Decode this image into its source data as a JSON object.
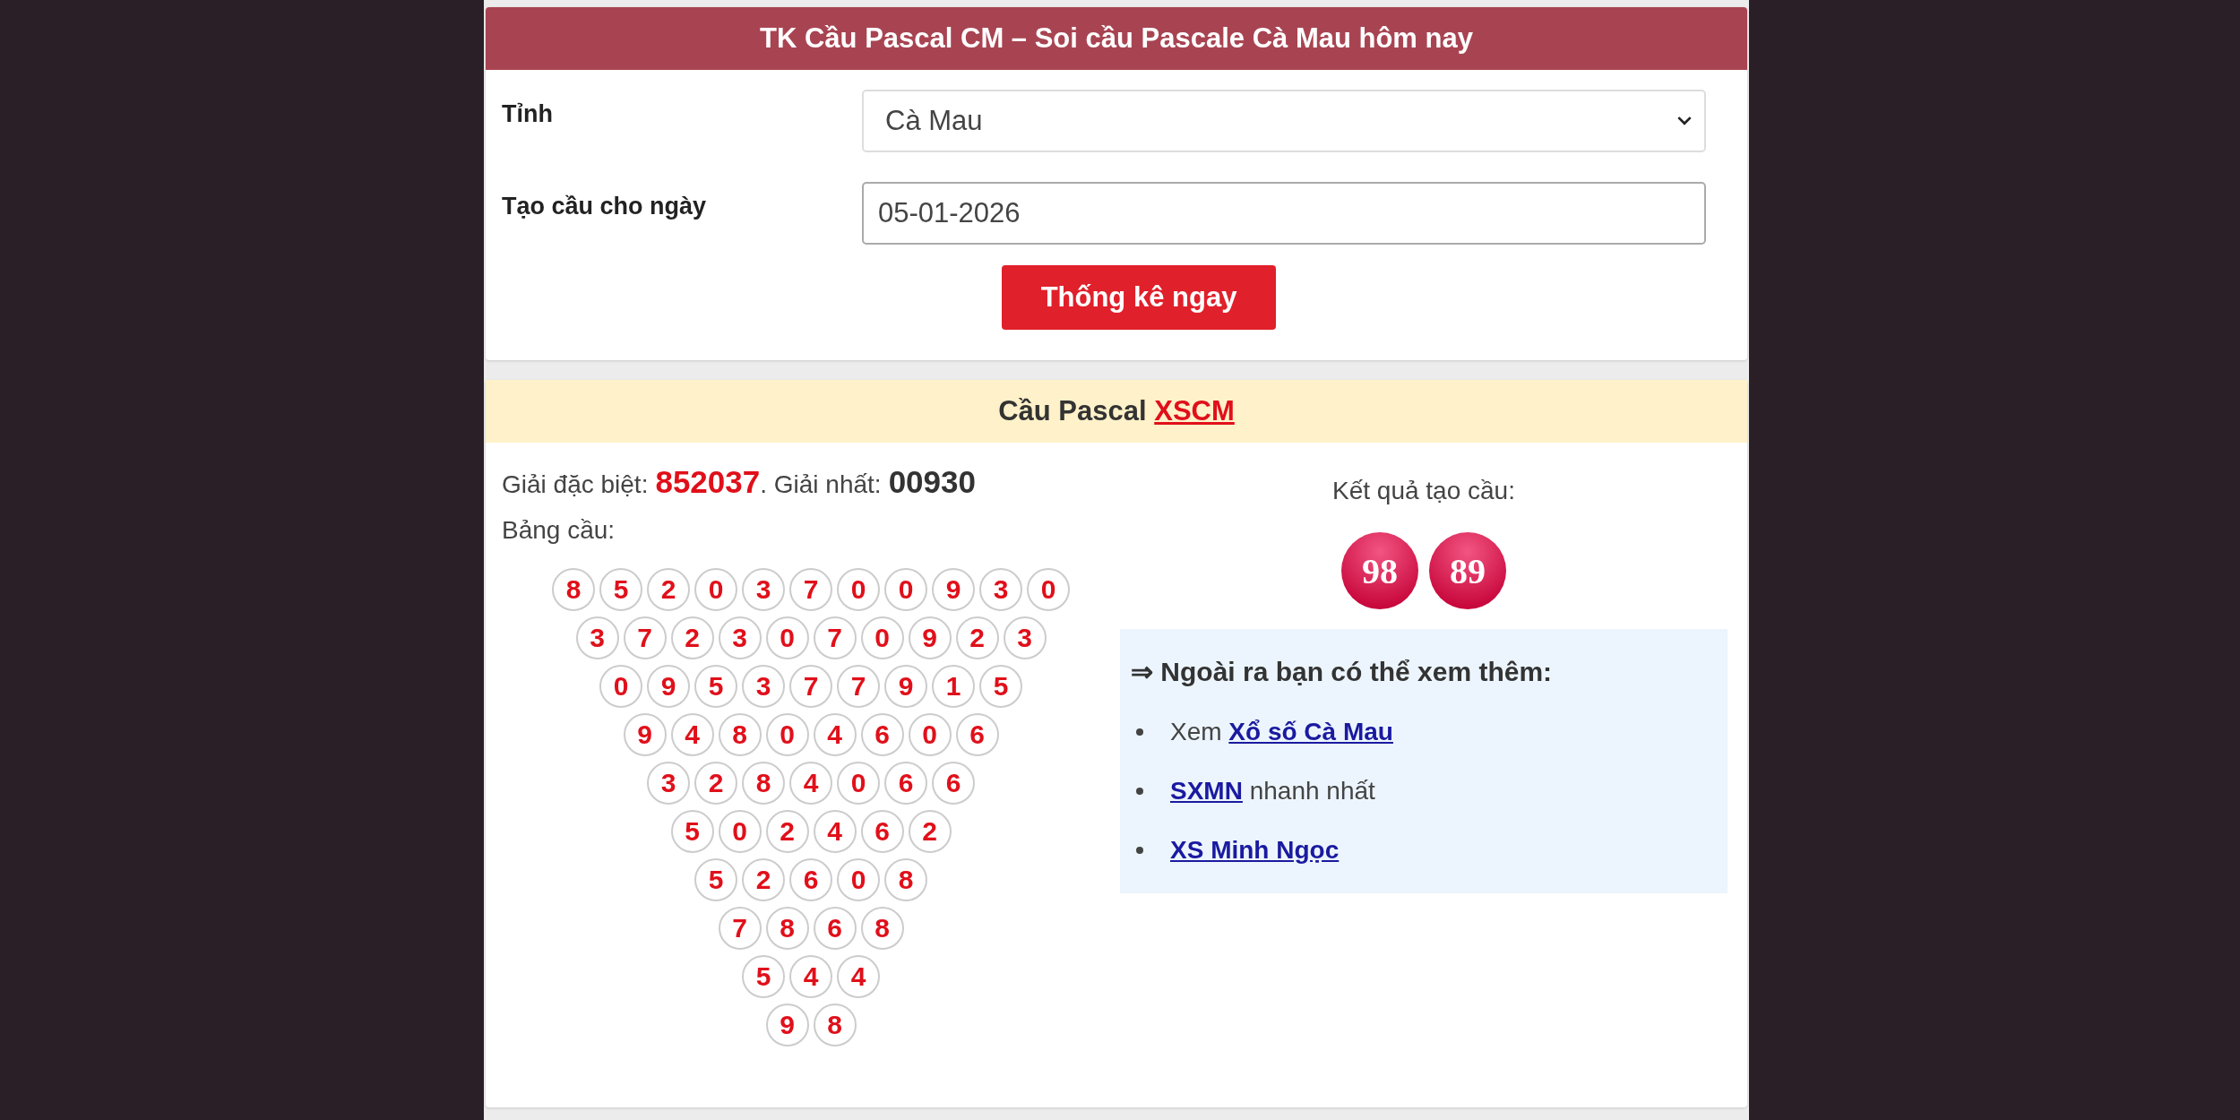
{
  "form_card": {
    "title": "TK Cầu Pascal CM – Soi cầu Pascale Cà Mau hôm nay",
    "fields": [
      {
        "kind": "select",
        "label": "Tỉnh",
        "value": "Cà Mau"
      },
      {
        "kind": "input",
        "label": "Tạo cầu cho ngày",
        "value": "05-01-2026"
      }
    ],
    "submit": "Thống kê ngay"
  },
  "result_card": {
    "title": "Cầu Pascal",
    "title_link": "XSCM",
    "special_label": "Giải đặc biệt:",
    "special_value": "852037",
    "first_label": ". Giải nhất:",
    "first_value": "00930",
    "table_label": "Bảng cầu:",
    "triangle": [
      [
        "8",
        "5",
        "2",
        "0",
        "3",
        "7",
        "0",
        "0",
        "9",
        "3",
        "0"
      ],
      [
        "3",
        "7",
        "2",
        "3",
        "0",
        "7",
        "0",
        "9",
        "2",
        "3"
      ],
      [
        "0",
        "9",
        "5",
        "3",
        "7",
        "7",
        "9",
        "1",
        "5"
      ],
      [
        "9",
        "4",
        "8",
        "0",
        "4",
        "6",
        "0",
        "6"
      ],
      [
        "3",
        "2",
        "8",
        "4",
        "0",
        "6",
        "6"
      ],
      [
        "5",
        "0",
        "2",
        "4",
        "6",
        "2"
      ],
      [
        "5",
        "2",
        "6",
        "0",
        "8"
      ],
      [
        "7",
        "8",
        "6",
        "8"
      ],
      [
        "5",
        "4",
        "4"
      ],
      [
        "9",
        "8"
      ]
    ],
    "result_label": "Kết quả tạo cầu:",
    "results": [
      "98",
      "89"
    ],
    "more": {
      "heading": "⇒ Ngoài ra bạn có thể xem thêm:",
      "links": [
        {
          "before": "Xem ",
          "link": "Xổ số Cà Mau"
        },
        {
          "link": "SXMN",
          "after": " nhanh nhất"
        },
        {
          "link": "XS Minh Ngọc"
        }
      ]
    }
  }
}
